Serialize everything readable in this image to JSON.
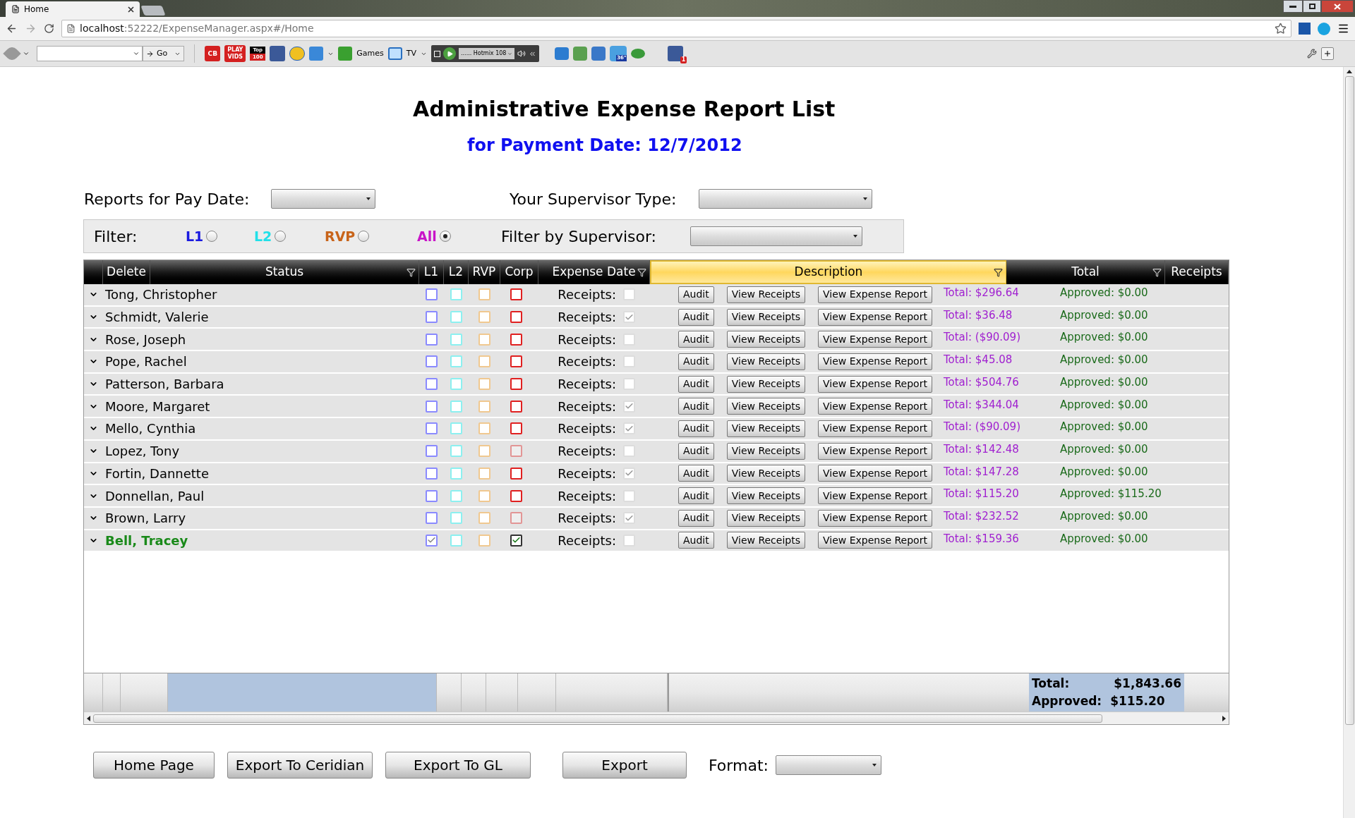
{
  "browser": {
    "tabs": [
      {
        "title": "Home",
        "selected": true
      }
    ],
    "url_host": "localhost",
    "url_rest": ":52222/ExpenseManager.aspx#/Home",
    "toolbar": {
      "go": "Go",
      "cb": "CB",
      "play": "PLAY",
      "vids": "VIDS",
      "top": "Top",
      "top_num": "100",
      "games": "Games",
      "tv": "TV",
      "station": "...... Hotmix 108",
      "weather": "36°",
      "fb_badge": "1"
    }
  },
  "page": {
    "title": "Administrative Expense Report List",
    "subtitle": "for Payment Date: 12/7/2012",
    "pay_date_label": "Reports for Pay Date:",
    "supervisor_type_label": "Your Supervisor Type:",
    "filter_label": "Filter:",
    "filter_options": [
      {
        "label": "L1",
        "color": "#1a1ae0",
        "selected": false
      },
      {
        "label": "L2",
        "color": "#22e0e8",
        "selected": false
      },
      {
        "label": "RVP",
        "color": "#c8641a",
        "selected": false
      },
      {
        "label": "All",
        "color": "#c814c8",
        "selected": true
      }
    ],
    "filter_supervisor_label": "Filter by Supervisor:"
  },
  "table": {
    "columns": [
      {
        "label": "Delete",
        "filter": false,
        "highlighted": false
      },
      {
        "label": "Status",
        "filter": true,
        "highlighted": false
      },
      {
        "label": "L1",
        "filter": false,
        "highlighted": false
      },
      {
        "label": "L2",
        "filter": false,
        "highlighted": false
      },
      {
        "label": "RVP",
        "filter": false,
        "highlighted": false
      },
      {
        "label": "Corp",
        "filter": false,
        "highlighted": false
      },
      {
        "label": "Expense Date",
        "filter": true,
        "highlighted": false
      },
      {
        "label": "Description",
        "filter": true,
        "highlighted": true
      },
      {
        "label": "Total",
        "filter": true,
        "highlighted": false
      },
      {
        "label": "Receipts",
        "filter": false,
        "highlighted": false
      }
    ],
    "rows": [
      {
        "name": "Tong, Christopher",
        "selected": false,
        "l1": false,
        "l2": false,
        "rvp": false,
        "corp": false,
        "corp_disabled": false,
        "receipts_label": "Receipts:",
        "receipts": false,
        "buttons": [
          "Audit",
          "View Receipts",
          "View Expense Report"
        ],
        "total": "Total: $296.64",
        "approved": "Approved: $0.00"
      },
      {
        "name": "Schmidt, Valerie",
        "selected": false,
        "l1": false,
        "l2": false,
        "rvp": false,
        "corp": false,
        "corp_disabled": false,
        "receipts_label": "Receipts:",
        "receipts": true,
        "buttons": [
          "Audit",
          "View Receipts",
          "View Expense Report"
        ],
        "total": "Total: $36.48",
        "approved": "Approved: $0.00"
      },
      {
        "name": "Rose, Joseph",
        "selected": false,
        "l1": false,
        "l2": false,
        "rvp": false,
        "corp": false,
        "corp_disabled": false,
        "receipts_label": "Receipts:",
        "receipts": false,
        "buttons": [
          "Audit",
          "View Receipts",
          "View Expense Report"
        ],
        "total": "Total: ($90.09)",
        "approved": "Approved: $0.00"
      },
      {
        "name": "Pope, Rachel",
        "selected": false,
        "l1": false,
        "l2": false,
        "rvp": false,
        "corp": false,
        "corp_disabled": false,
        "receipts_label": "Receipts:",
        "receipts": false,
        "buttons": [
          "Audit",
          "View Receipts",
          "View Expense Report"
        ],
        "total": "Total: $45.08",
        "approved": "Approved: $0.00"
      },
      {
        "name": "Patterson, Barbara",
        "selected": false,
        "l1": false,
        "l2": false,
        "rvp": false,
        "corp": false,
        "corp_disabled": false,
        "receipts_label": "Receipts:",
        "receipts": false,
        "buttons": [
          "Audit",
          "View Receipts",
          "View Expense Report"
        ],
        "total": "Total: $504.76",
        "approved": "Approved: $0.00"
      },
      {
        "name": "Moore, Margaret",
        "selected": false,
        "l1": false,
        "l2": false,
        "rvp": false,
        "corp": false,
        "corp_disabled": false,
        "receipts_label": "Receipts:",
        "receipts": true,
        "buttons": [
          "Audit",
          "View Receipts",
          "View Expense Report"
        ],
        "total": "Total: $344.04",
        "approved": "Approved: $0.00"
      },
      {
        "name": "Mello, Cynthia",
        "selected": false,
        "l1": false,
        "l2": false,
        "rvp": false,
        "corp": false,
        "corp_disabled": false,
        "receipts_label": "Receipts:",
        "receipts": true,
        "buttons": [
          "Audit",
          "View Receipts",
          "View Expense Report"
        ],
        "total": "Total: ($90.09)",
        "approved": "Approved: $0.00"
      },
      {
        "name": "Lopez, Tony",
        "selected": false,
        "l1": false,
        "l2": false,
        "rvp": false,
        "corp": false,
        "corp_disabled": true,
        "receipts_label": "Receipts:",
        "receipts": false,
        "buttons": [
          "Audit",
          "View Receipts",
          "View Expense Report"
        ],
        "total": "Total: $142.48",
        "approved": "Approved: $0.00"
      },
      {
        "name": "Fortin, Dannette",
        "selected": false,
        "l1": false,
        "l2": false,
        "rvp": false,
        "corp": false,
        "corp_disabled": false,
        "receipts_label": "Receipts:",
        "receipts": true,
        "buttons": [
          "Audit",
          "View Receipts",
          "View Expense Report"
        ],
        "total": "Total: $147.28",
        "approved": "Approved: $0.00"
      },
      {
        "name": "Donnellan, Paul",
        "selected": false,
        "l1": false,
        "l2": false,
        "rvp": false,
        "corp": false,
        "corp_disabled": false,
        "receipts_label": "Receipts:",
        "receipts": false,
        "buttons": [
          "Audit",
          "View Receipts",
          "View Expense Report"
        ],
        "total": "Total: $115.20",
        "approved": "Approved: $115.20"
      },
      {
        "name": "Brown, Larry",
        "selected": false,
        "l1": false,
        "l2": false,
        "rvp": false,
        "corp": false,
        "corp_disabled": true,
        "receipts_label": "Receipts:",
        "receipts": true,
        "buttons": [
          "Audit",
          "View Receipts",
          "View Expense Report"
        ],
        "total": "Total: $232.52",
        "approved": "Approved: $0.00"
      },
      {
        "name": "Bell, Tracey",
        "selected": true,
        "l1": true,
        "l2": false,
        "rvp": false,
        "corp": true,
        "corp_disabled": false,
        "receipts_label": "Receipts:",
        "receipts": false,
        "buttons": [
          "Audit",
          "View Receipts",
          "View Expense Report"
        ],
        "total": "Total: $159.36",
        "approved": "Approved: $0.00"
      }
    ],
    "footer": {
      "total_label": "Total:",
      "total": "$1,843.66",
      "approved_label": "Approved:",
      "approved": "$115.20"
    }
  },
  "buttons": [
    "Home Page",
    "Export To Ceridian",
    "Export To GL",
    "Export"
  ],
  "format_label": "Format:"
}
